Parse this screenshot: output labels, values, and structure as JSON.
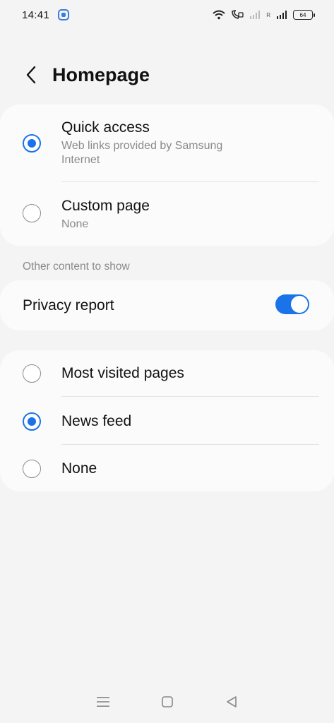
{
  "status_bar": {
    "time": "14:41",
    "battery": "64",
    "roaming_label": "R"
  },
  "header": {
    "title": "Homepage"
  },
  "homepage_options": [
    {
      "title": "Quick access",
      "subtitle": "Web links provided by Samsung Internet",
      "selected": true
    },
    {
      "title": "Custom page",
      "subtitle": "None",
      "selected": false
    }
  ],
  "other_content": {
    "section_label": "Other content to show",
    "privacy_report_label": "Privacy report",
    "privacy_report_enabled": true
  },
  "content_options": [
    {
      "title": "Most visited pages",
      "selected": false
    },
    {
      "title": "News feed",
      "selected": true
    },
    {
      "title": "None",
      "selected": false
    }
  ],
  "colors": {
    "accent": "#1a73e8",
    "background": "#f4f4f4",
    "card": "#fbfbfb"
  },
  "icons": {
    "back": "chevron-left-icon",
    "nav_recent": "menu-lines-icon",
    "nav_home": "square-icon",
    "nav_back": "triangle-back-icon"
  }
}
